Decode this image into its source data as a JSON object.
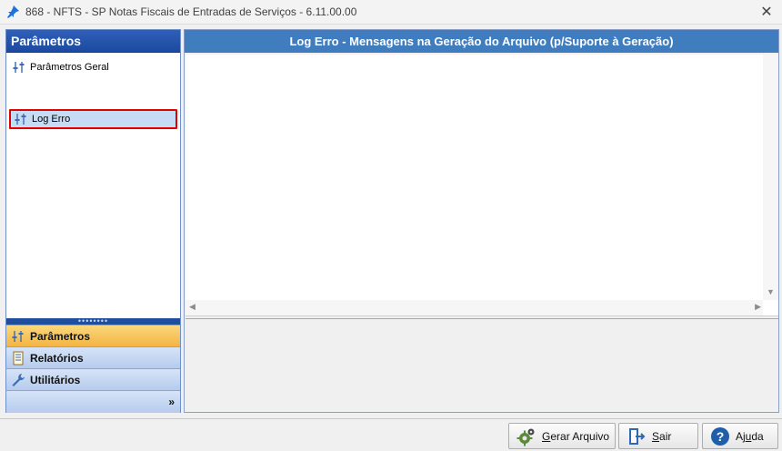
{
  "window": {
    "title": "868 - NFTS - SP  Notas Fiscais de Entradas de Serviços - 6.11.00.00",
    "close_glyph": "✕"
  },
  "nav": {
    "header": "Parâmetros",
    "tree_items": [
      {
        "label": "Parâmetros Geral",
        "icon": "sliders-icon",
        "selected": false
      },
      {
        "label": "Log Erro",
        "icon": "sliders-icon",
        "selected": true
      }
    ],
    "splitter_dots": "••••••••",
    "buttons": [
      {
        "label": "Parâmetros",
        "icon": "sliders-icon",
        "active": true
      },
      {
        "label": "Relatórios",
        "icon": "report-icon",
        "active": false
      },
      {
        "label": "Utilitários",
        "icon": "wrench-icon",
        "active": false
      }
    ],
    "more_glyph": "»"
  },
  "panel": {
    "header": "Log Erro - Mensagens na Geração do Arquivo (p/Suporte à Geração)",
    "log_text": ""
  },
  "actions": {
    "generate": {
      "prefix": "",
      "underline": "G",
      "rest": "erar Arquivo"
    },
    "exit": {
      "prefix": "",
      "underline": "S",
      "rest": "air"
    },
    "help": {
      "prefix": "Aj",
      "underline": "u",
      "rest": "da"
    }
  },
  "colors": {
    "nav_header": "#1c4aa0",
    "panel_header": "#3f7dbf",
    "active_nav": "#f3b443",
    "selection_outline": "#e00000"
  }
}
